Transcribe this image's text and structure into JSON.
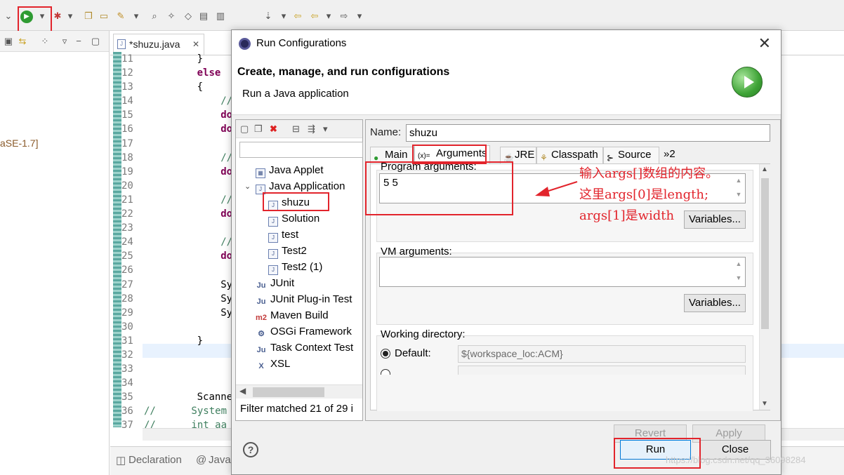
{
  "colors": {
    "annotation_red": "#e2242c",
    "run_green": "#2e9b32",
    "eclipse_bg": "#f0f0f0"
  },
  "background": {
    "left_panel_snippet": "aSE-1.7]",
    "editor_tab": "*shuzu.java",
    "line_numbers": [
      "11",
      "12",
      "13",
      "14",
      "15",
      "16",
      "17",
      "18",
      "19",
      "20",
      "21",
      "22",
      "23",
      "24",
      "25",
      "26",
      "27",
      "28",
      "29",
      "30",
      "31",
      "32",
      "33",
      "34",
      "35",
      "36",
      "37"
    ],
    "code_lines": [
      "}",
      "else",
      "{",
      "//",
      "do",
      "do",
      "",
      "//",
      "do",
      "",
      "//",
      "do",
      "",
      "//",
      "do",
      "",
      "Sy",
      "Sy",
      "Sy",
      "",
      "}",
      "",
      "",
      "",
      "Scanne",
      "//      System",
      "//      int aa"
    ],
    "bottom_tabs": [
      "Declaration",
      "Javad"
    ]
  },
  "dialog": {
    "title": "Run Configurations",
    "header": "Create, manage, and run configurations",
    "subheader": "Run a Java application",
    "tree": [
      {
        "label": "Java Applet",
        "icon": "applet-icon",
        "level": 1
      },
      {
        "label": "Java Application",
        "icon": "java-app-icon",
        "level": 1,
        "expanded": true
      },
      {
        "label": "shuzu",
        "icon": "java-config-icon",
        "level": 2,
        "selected": true
      },
      {
        "label": "Solution",
        "icon": "java-config-icon",
        "level": 2
      },
      {
        "label": "test",
        "icon": "java-config-icon",
        "level": 2
      },
      {
        "label": "Test2",
        "icon": "java-config-icon",
        "level": 2
      },
      {
        "label": "Test2 (1)",
        "icon": "java-config-icon",
        "level": 2
      },
      {
        "label": "JUnit",
        "icon": "junit-icon",
        "level": 1
      },
      {
        "label": "JUnit Plug-in Test",
        "icon": "junit-plugin-icon",
        "level": 1
      },
      {
        "label": "Maven Build",
        "icon": "maven-icon",
        "level": 1
      },
      {
        "label": "OSGi Framework",
        "icon": "osgi-icon",
        "level": 1
      },
      {
        "label": "Task Context Test",
        "icon": "task-context-icon",
        "level": 1
      },
      {
        "label": "XSL",
        "icon": "xsl-icon",
        "level": 1
      }
    ],
    "filter_status": "Filter matched 21 of 29 i",
    "name_label": "Name:",
    "name_value": "shuzu",
    "tabs": [
      {
        "label": "Main",
        "icon": "main-tab-icon"
      },
      {
        "label": "Arguments",
        "icon": "arguments-tab-icon",
        "active": true
      },
      {
        "label": "JRE",
        "icon": "jre-tab-icon"
      },
      {
        "label": "Classpath",
        "icon": "classpath-tab-icon"
      },
      {
        "label": "Source",
        "icon": "source-tab-icon"
      },
      {
        "label": "»2",
        "icon": ""
      }
    ],
    "program_args_label": "Program arguments:",
    "program_args_value": "5 5",
    "variables_label": "Variables...",
    "vm_args_label": "VM arguments:",
    "vm_args_value": "",
    "working_dir_label": "Working directory:",
    "default_label": "Default:",
    "default_value": "${workspace_loc:ACM}",
    "revert_label": "Revert",
    "apply_label": "Apply",
    "run_label": "Run",
    "close_label": "Close"
  },
  "annotation": {
    "line1": "输入args[]数组的内容。",
    "line2": "这里args[0]是length;",
    "line3": "args[1]是width"
  },
  "watermark": "https://blog.csdn.net/qq_36098284"
}
